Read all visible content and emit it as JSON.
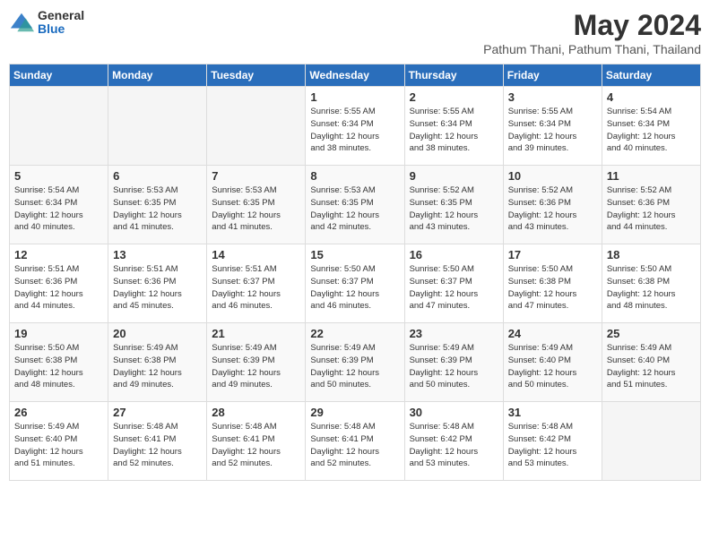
{
  "logo": {
    "general": "General",
    "blue": "Blue"
  },
  "title": "May 2024",
  "subtitle": "Pathum Thani, Pathum Thani, Thailand",
  "days_of_week": [
    "Sunday",
    "Monday",
    "Tuesday",
    "Wednesday",
    "Thursday",
    "Friday",
    "Saturday"
  ],
  "weeks": [
    [
      {
        "day": "",
        "detail": ""
      },
      {
        "day": "",
        "detail": ""
      },
      {
        "day": "",
        "detail": ""
      },
      {
        "day": "1",
        "detail": "Sunrise: 5:55 AM\nSunset: 6:34 PM\nDaylight: 12 hours\nand 38 minutes."
      },
      {
        "day": "2",
        "detail": "Sunrise: 5:55 AM\nSunset: 6:34 PM\nDaylight: 12 hours\nand 38 minutes."
      },
      {
        "day": "3",
        "detail": "Sunrise: 5:55 AM\nSunset: 6:34 PM\nDaylight: 12 hours\nand 39 minutes."
      },
      {
        "day": "4",
        "detail": "Sunrise: 5:54 AM\nSunset: 6:34 PM\nDaylight: 12 hours\nand 40 minutes."
      }
    ],
    [
      {
        "day": "5",
        "detail": "Sunrise: 5:54 AM\nSunset: 6:34 PM\nDaylight: 12 hours\nand 40 minutes."
      },
      {
        "day": "6",
        "detail": "Sunrise: 5:53 AM\nSunset: 6:35 PM\nDaylight: 12 hours\nand 41 minutes."
      },
      {
        "day": "7",
        "detail": "Sunrise: 5:53 AM\nSunset: 6:35 PM\nDaylight: 12 hours\nand 41 minutes."
      },
      {
        "day": "8",
        "detail": "Sunrise: 5:53 AM\nSunset: 6:35 PM\nDaylight: 12 hours\nand 42 minutes."
      },
      {
        "day": "9",
        "detail": "Sunrise: 5:52 AM\nSunset: 6:35 PM\nDaylight: 12 hours\nand 43 minutes."
      },
      {
        "day": "10",
        "detail": "Sunrise: 5:52 AM\nSunset: 6:36 PM\nDaylight: 12 hours\nand 43 minutes."
      },
      {
        "day": "11",
        "detail": "Sunrise: 5:52 AM\nSunset: 6:36 PM\nDaylight: 12 hours\nand 44 minutes."
      }
    ],
    [
      {
        "day": "12",
        "detail": "Sunrise: 5:51 AM\nSunset: 6:36 PM\nDaylight: 12 hours\nand 44 minutes."
      },
      {
        "day": "13",
        "detail": "Sunrise: 5:51 AM\nSunset: 6:36 PM\nDaylight: 12 hours\nand 45 minutes."
      },
      {
        "day": "14",
        "detail": "Sunrise: 5:51 AM\nSunset: 6:37 PM\nDaylight: 12 hours\nand 46 minutes."
      },
      {
        "day": "15",
        "detail": "Sunrise: 5:50 AM\nSunset: 6:37 PM\nDaylight: 12 hours\nand 46 minutes."
      },
      {
        "day": "16",
        "detail": "Sunrise: 5:50 AM\nSunset: 6:37 PM\nDaylight: 12 hours\nand 47 minutes."
      },
      {
        "day": "17",
        "detail": "Sunrise: 5:50 AM\nSunset: 6:38 PM\nDaylight: 12 hours\nand 47 minutes."
      },
      {
        "day": "18",
        "detail": "Sunrise: 5:50 AM\nSunset: 6:38 PM\nDaylight: 12 hours\nand 48 minutes."
      }
    ],
    [
      {
        "day": "19",
        "detail": "Sunrise: 5:50 AM\nSunset: 6:38 PM\nDaylight: 12 hours\nand 48 minutes."
      },
      {
        "day": "20",
        "detail": "Sunrise: 5:49 AM\nSunset: 6:38 PM\nDaylight: 12 hours\nand 49 minutes."
      },
      {
        "day": "21",
        "detail": "Sunrise: 5:49 AM\nSunset: 6:39 PM\nDaylight: 12 hours\nand 49 minutes."
      },
      {
        "day": "22",
        "detail": "Sunrise: 5:49 AM\nSunset: 6:39 PM\nDaylight: 12 hours\nand 50 minutes."
      },
      {
        "day": "23",
        "detail": "Sunrise: 5:49 AM\nSunset: 6:39 PM\nDaylight: 12 hours\nand 50 minutes."
      },
      {
        "day": "24",
        "detail": "Sunrise: 5:49 AM\nSunset: 6:40 PM\nDaylight: 12 hours\nand 50 minutes."
      },
      {
        "day": "25",
        "detail": "Sunrise: 5:49 AM\nSunset: 6:40 PM\nDaylight: 12 hours\nand 51 minutes."
      }
    ],
    [
      {
        "day": "26",
        "detail": "Sunrise: 5:49 AM\nSunset: 6:40 PM\nDaylight: 12 hours\nand 51 minutes."
      },
      {
        "day": "27",
        "detail": "Sunrise: 5:48 AM\nSunset: 6:41 PM\nDaylight: 12 hours\nand 52 minutes."
      },
      {
        "day": "28",
        "detail": "Sunrise: 5:48 AM\nSunset: 6:41 PM\nDaylight: 12 hours\nand 52 minutes."
      },
      {
        "day": "29",
        "detail": "Sunrise: 5:48 AM\nSunset: 6:41 PM\nDaylight: 12 hours\nand 52 minutes."
      },
      {
        "day": "30",
        "detail": "Sunrise: 5:48 AM\nSunset: 6:42 PM\nDaylight: 12 hours\nand 53 minutes."
      },
      {
        "day": "31",
        "detail": "Sunrise: 5:48 AM\nSunset: 6:42 PM\nDaylight: 12 hours\nand 53 minutes."
      },
      {
        "day": "",
        "detail": ""
      }
    ]
  ]
}
